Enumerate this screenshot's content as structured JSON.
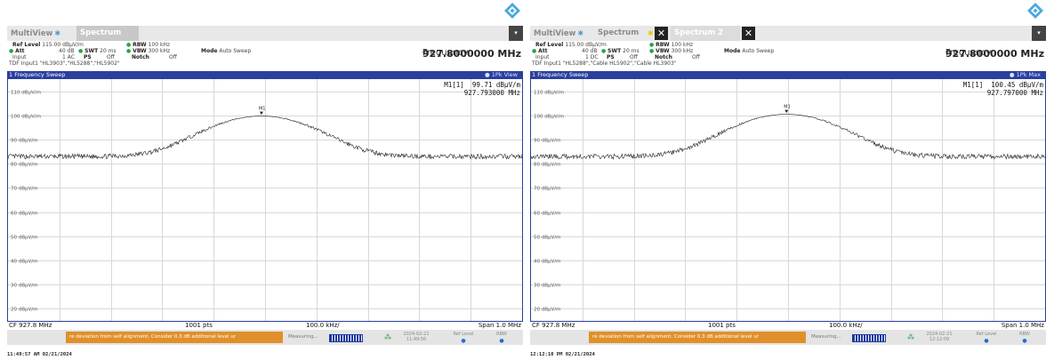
{
  "panels": [
    {
      "tabs": {
        "multiview": "MultiView",
        "spectrum": "Spectrum",
        "spectrum2": ""
      },
      "has_close_tabs": false,
      "settings": {
        "ref_level_label": "Ref Level",
        "ref_level_value": "115.00 dBµV/m",
        "att_label": "Att",
        "att_value": "40 dB",
        "swt_label": "SWT",
        "swt_value": "20 ms",
        "rbw_label": "RBW",
        "rbw_value": "100 kHz",
        "vbw_label": "VBW",
        "vbw_value": "300 kHz",
        "mode_label": "Mode",
        "mode_value": "Auto Sweep",
        "input_label": "Input",
        "input_value": "1 AC",
        "ps_label": "PS",
        "ps_value": "Off",
        "notch_label": "Notch",
        "notch_value": "Off",
        "tdf": "TDF Input1 \"HL3903\",\"HL5288\",\"HL5902\""
      },
      "frequency_label": "Frequency",
      "frequency_value": "927.8000000 MHz",
      "window_title": "1 Frequency Sweep",
      "trace_label": "1Pk View",
      "marker": {
        "name": "M1[1]",
        "level": "99.71 dBµV/m",
        "freq": "927.793000 MHz",
        "label": "M1"
      },
      "y_labels": [
        "110 dBµV/m",
        "100 dBµV/m",
        "90 dBµV/m",
        "80 dBµV/m",
        "70 dBµV/m",
        "60 dBµV/m",
        "50 dBµV/m",
        "40 dBµV/m",
        "30 dBµV/m",
        "20 dBµV/m"
      ],
      "footer": {
        "cf": "CF 927.8 MHz",
        "pts": "1001 pts",
        "div": "100.0 kHz/",
        "span": "Span 1.0 MHz"
      },
      "status": {
        "warning": "re deviation from self alignment. Consider 0.3 dB additional level ur",
        "measuring": "Measuring...",
        "date": "2024-02-21",
        "time": "11:49:56",
        "ref_level": "Ref Level",
        "rbw": "RBW"
      },
      "screen_time": "11:49:57 AM  02/21/2024",
      "chart_data": {
        "type": "line",
        "x_range_mhz": [
          927.3,
          928.3
        ],
        "ylim": [
          15,
          115
        ],
        "y_unit": "dBµV/m",
        "peak": {
          "x": 927.793,
          "y": 99.71
        },
        "noise_floor": 83,
        "grid": true
      }
    },
    {
      "tabs": {
        "multiview": "MultiView",
        "spectrum": "Spectrum",
        "spectrum2": "Spectrum 2"
      },
      "has_close_tabs": true,
      "settings": {
        "ref_level_label": "Ref Level",
        "ref_level_value": "115.00 dBµV/m",
        "att_label": "Att",
        "att_value": "40 dB",
        "swt_label": "SWT",
        "swt_value": "20 ms",
        "rbw_label": "RBW",
        "rbw_value": "100 kHz",
        "vbw_label": "VBW",
        "vbw_value": "300 kHz",
        "mode_label": "Mode",
        "mode_value": "Auto Sweep",
        "input_label": "Input",
        "input_value": "1 DC",
        "ps_label": "PS",
        "ps_value": "Off",
        "notch_label": "Notch",
        "notch_value": "Off",
        "tdf": "TDF Input1 \"HL5288\",\"Cable HL5902\",\"Cable HL3903\""
      },
      "frequency_label": "Frequency",
      "frequency_value": "927.8000000 MHz",
      "window_title": "1 Frequency Sweep",
      "trace_label": "1Pk Max",
      "marker": {
        "name": "M1[1]",
        "level": "100.45 dBµV/m",
        "freq": "927.797000 MHz",
        "label": "M1"
      },
      "y_labels": [
        "110 dBµV/m",
        "100 dBµV/m",
        "90 dBµV/m",
        "80 dBµV/m",
        "70 dBµV/m",
        "60 dBµV/m",
        "50 dBµV/m",
        "40 dBµV/m",
        "30 dBµV/m",
        "20 dBµV/m"
      ],
      "footer": {
        "cf": "CF 927.8 MHz",
        "pts": "1001 pts",
        "div": "100.0 kHz/",
        "span": "Span 1.0 MHz"
      },
      "status": {
        "warning": "re deviation from self alignment. Consider 0.3 dB additional level ur",
        "measuring": "Measuring...",
        "date": "2024-02-21",
        "time": "12:12:09",
        "ref_level": "Ref Level",
        "rbw": "RBW"
      },
      "screen_time": "12:12:10 PM  02/21/2024",
      "chart_data": {
        "type": "line",
        "x_range_mhz": [
          927.3,
          928.3
        ],
        "ylim": [
          15,
          115
        ],
        "y_unit": "dBµV/m",
        "peak": {
          "x": 927.797,
          "y": 100.45
        },
        "noise_floor": 83,
        "grid": true
      }
    }
  ],
  "colors": {
    "accent": "#2b3f9e",
    "warning": "#e0902a",
    "trace": "#222222",
    "grid": "#d8d8d8"
  },
  "icons": {
    "logo": "rohde-schwarz-diamond-icon",
    "close": "close-icon",
    "dropdown": "dropdown-icon"
  }
}
